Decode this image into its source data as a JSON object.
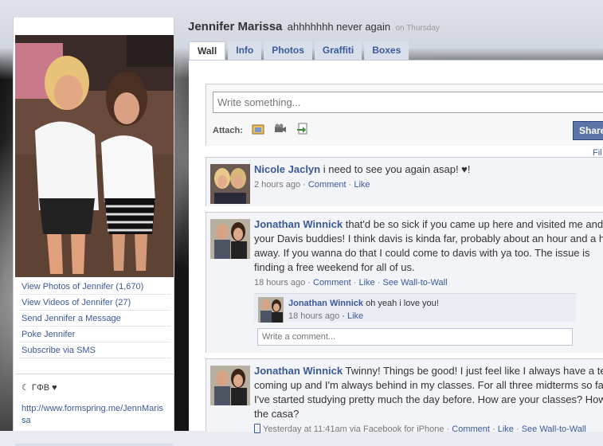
{
  "profile": {
    "name": "Jennifer Marissa",
    "status": "ahhhhhhh never again",
    "status_time": "on Thursday"
  },
  "tabs": [
    "Wall",
    "Info",
    "Photos",
    "Graffiti",
    "Boxes"
  ],
  "left": {
    "links": [
      "View Photos of Jennifer (1,670)",
      "View Videos of Jennifer (27)",
      "Send Jennifer a Message",
      "Poke Jennifer",
      "Subscribe via SMS"
    ],
    "sorority": "☾ ΓΦΒ ♥",
    "formspring": "http://www.formspring.me/JennMarissa"
  },
  "publisher": {
    "placeholder": "Write something...",
    "attach_label": "Attach:",
    "share_label": "Share",
    "filter_label": "Fil"
  },
  "posts": [
    {
      "author": "Nicole Jaclyn",
      "text": " i need to see you again asap! ♥!",
      "time": "2 hours ago",
      "comment_link": "Comment",
      "like_link": "Like"
    },
    {
      "author": "Jonathan Winnick",
      "text": " that'd be so sick if you came up here and visited me and your Davis buddies! I think davis is kinda far, probably about an hour and a half away. If you wanna do that I could come to davis with ya too. The issue is finding a free weekend for all of us.",
      "time": "18 hours ago",
      "comment_link": "Comment",
      "like_link": "Like",
      "wall_link": "See Wall-to-Wall",
      "reply": {
        "author": "Jonathan Winnick",
        "text": " oh yeah i love you!",
        "time": "18 hours ago",
        "like_link": "Like"
      },
      "comment_placeholder": "Write a comment..."
    },
    {
      "author": "Jonathan Winnick",
      "text": " Twinny! Things be good! I just feel like I always have a test coming up and I'm always behind in my classes. For all three midterms so far I've started studying pretty much the day before. How are your classes? How's the casa?",
      "time": "Yesterday at 11:41am via Facebook for iPhone",
      "comment_link": "Comment",
      "like_link": "Like",
      "wall_link": "See Wall-to-Wall"
    }
  ]
}
